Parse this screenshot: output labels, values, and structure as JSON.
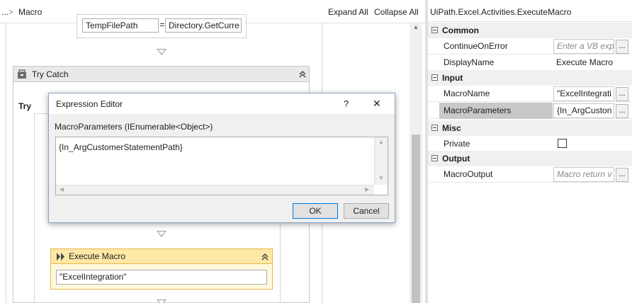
{
  "breadcrumb": {
    "prefix": "...",
    "separator": ">",
    "current": "Macro"
  },
  "toolbar": {
    "expand_all": "Expand All",
    "collapse_all": "Collapse All"
  },
  "designer": {
    "assign": {
      "left": "TempFilePath",
      "operator": "=",
      "right": "Directory.GetCurre"
    },
    "trycatch": {
      "title": "Try Catch",
      "try_label": "Try"
    },
    "execute_macro": {
      "title": "Execute Macro",
      "value": "\"ExcelIntegration\""
    }
  },
  "dialog": {
    "title": "Expression Editor",
    "help": "?",
    "close": "✕",
    "prompt": "MacroParameters (IEnumerable<Object>)",
    "expression": "{In_ArgCustomerStatementPath}",
    "ok": "OK",
    "cancel": "Cancel"
  },
  "properties": {
    "title": "UiPath.Excel.Activities.ExecuteMacro",
    "categories": [
      {
        "name": "Common",
        "rows": [
          {
            "name": "ContinueOnError",
            "value": "Enter a VB exp",
            "placeholder": true,
            "button": "..."
          },
          {
            "name": "DisplayName",
            "value": "Execute Macro",
            "placeholder": false,
            "button": ""
          }
        ]
      },
      {
        "name": "Input",
        "rows": [
          {
            "name": "MacroName",
            "value": "\"ExcelIntegrati",
            "placeholder": false,
            "button": "..."
          },
          {
            "name": "MacroParameters",
            "value": "{In_ArgCuston",
            "placeholder": false,
            "button": "..."
          }
        ]
      },
      {
        "name": "Misc",
        "rows": [
          {
            "name": "Private",
            "value": "",
            "placeholder": false,
            "button": ""
          }
        ]
      },
      {
        "name": "Output",
        "rows": [
          {
            "name": "MacroOutput",
            "value": "Macro return v",
            "placeholder": true,
            "button": "..."
          }
        ]
      }
    ]
  },
  "colors": {
    "accent": "#0078d7",
    "activity_header": "#fde8a6",
    "activity_border": "#e6b94a",
    "selected_row": "#c8c8c8"
  }
}
